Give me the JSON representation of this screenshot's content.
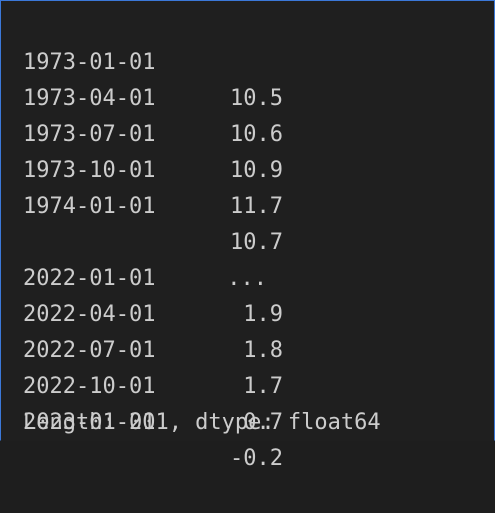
{
  "series": {
    "rows": [
      {
        "date": "1973-01-01",
        "value": "10.5"
      },
      {
        "date": "1973-04-01",
        "value": "10.6"
      },
      {
        "date": "1973-07-01",
        "value": "10.9"
      },
      {
        "date": "1973-10-01",
        "value": "11.7"
      },
      {
        "date": "1974-01-01",
        "value": "10.7"
      },
      {
        "date": "",
        "value": "..."
      },
      {
        "date": "2022-01-01",
        "value": "1.9"
      },
      {
        "date": "2022-04-01",
        "value": "1.8"
      },
      {
        "date": "2022-07-01",
        "value": "1.7"
      },
      {
        "date": "2022-10-01",
        "value": "0.7"
      },
      {
        "date": "2023-01-01",
        "value": "-0.2"
      }
    ],
    "footer": "Length: 201, dtype: float64"
  },
  "colors": {
    "background": "#1f1f1f",
    "text": "#cccccc",
    "focus_border": "#3b78d8"
  }
}
